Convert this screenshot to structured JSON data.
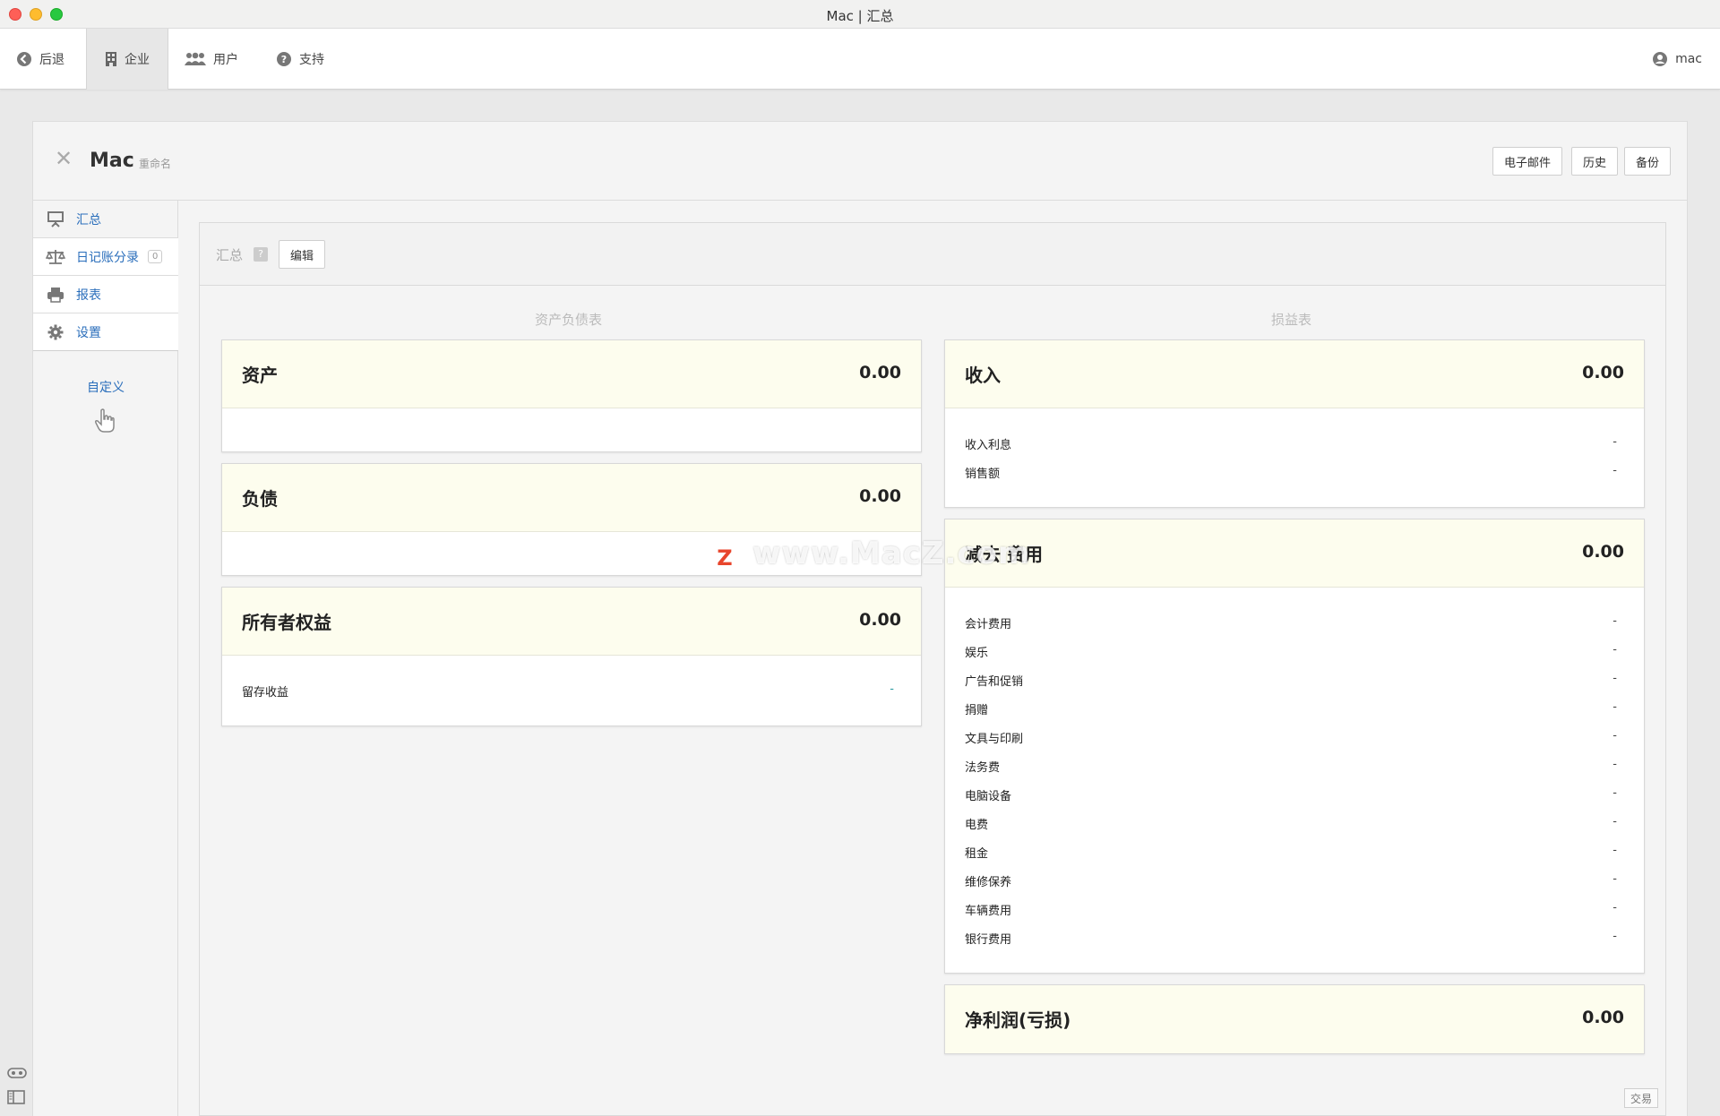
{
  "window": {
    "title": "Mac | 汇总"
  },
  "toolbar": {
    "back": "后退",
    "company": "企业",
    "users": "用户",
    "support": "支持",
    "user_name": "mac"
  },
  "header": {
    "business_name": "Mac",
    "rename": "重命名",
    "email_button": "电子邮件",
    "history_button": "历史",
    "backup_button": "备份"
  },
  "sidebar": {
    "items": [
      {
        "label": "汇总",
        "icon": "presentation-icon"
      },
      {
        "label": "日记账分录",
        "icon": "scale-icon",
        "badge": "0"
      },
      {
        "label": "报表",
        "icon": "printer-icon"
      },
      {
        "label": "设置",
        "icon": "gear-icon"
      }
    ],
    "customize": "自定义"
  },
  "content": {
    "header_label": "汇总",
    "help": "?",
    "edit_button": "编辑",
    "trade_button": "交易"
  },
  "balance_sheet": {
    "title": "资产负债表",
    "assets": {
      "title": "资产",
      "value": "0.00"
    },
    "liabilities": {
      "title": "负债",
      "value": "0.00"
    },
    "equity": {
      "title": "所有者权益",
      "value": "0.00",
      "lines": [
        {
          "label": "留存收益",
          "value": "-"
        }
      ]
    }
  },
  "income_statement": {
    "title": "损益表",
    "income": {
      "title": "收入",
      "value": "0.00",
      "lines": [
        {
          "label": "收入利息",
          "value": "-"
        },
        {
          "label": "销售额",
          "value": "-"
        }
      ]
    },
    "expenses": {
      "title": "减去 费用",
      "value": "0.00",
      "lines": [
        {
          "label": "会计费用",
          "value": "-"
        },
        {
          "label": "娱乐",
          "value": "-"
        },
        {
          "label": "广告和促销",
          "value": "-"
        },
        {
          "label": "捐赠",
          "value": "-"
        },
        {
          "label": "文具与印刷",
          "value": "-"
        },
        {
          "label": "法务费",
          "value": "-"
        },
        {
          "label": "电脑设备",
          "value": "-"
        },
        {
          "label": "电费",
          "value": "-"
        },
        {
          "label": "租金",
          "value": "-"
        },
        {
          "label": "维修保养",
          "value": "-"
        },
        {
          "label": "车辆费用",
          "value": "-"
        },
        {
          "label": "银行费用",
          "value": "-"
        }
      ]
    },
    "net_profit": {
      "title": "净利润(亏损)",
      "value": "0.00"
    }
  },
  "watermark": {
    "text": "www.MacZ.com",
    "logo": "Z"
  }
}
